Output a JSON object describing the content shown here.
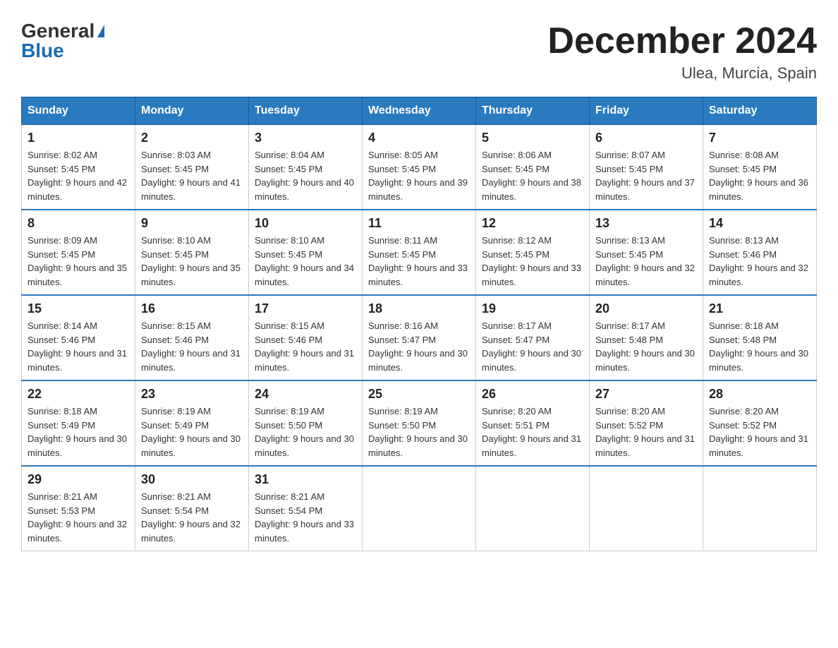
{
  "header": {
    "logo_general": "General",
    "logo_blue": "Blue",
    "month_title": "December 2024",
    "location": "Ulea, Murcia, Spain"
  },
  "days_of_week": [
    "Sunday",
    "Monday",
    "Tuesday",
    "Wednesday",
    "Thursday",
    "Friday",
    "Saturday"
  ],
  "weeks": [
    [
      {
        "day": "1",
        "sunrise": "8:02 AM",
        "sunset": "5:45 PM",
        "daylight": "9 hours and 42 minutes."
      },
      {
        "day": "2",
        "sunrise": "8:03 AM",
        "sunset": "5:45 PM",
        "daylight": "9 hours and 41 minutes."
      },
      {
        "day": "3",
        "sunrise": "8:04 AM",
        "sunset": "5:45 PM",
        "daylight": "9 hours and 40 minutes."
      },
      {
        "day": "4",
        "sunrise": "8:05 AM",
        "sunset": "5:45 PM",
        "daylight": "9 hours and 39 minutes."
      },
      {
        "day": "5",
        "sunrise": "8:06 AM",
        "sunset": "5:45 PM",
        "daylight": "9 hours and 38 minutes."
      },
      {
        "day": "6",
        "sunrise": "8:07 AM",
        "sunset": "5:45 PM",
        "daylight": "9 hours and 37 minutes."
      },
      {
        "day": "7",
        "sunrise": "8:08 AM",
        "sunset": "5:45 PM",
        "daylight": "9 hours and 36 minutes."
      }
    ],
    [
      {
        "day": "8",
        "sunrise": "8:09 AM",
        "sunset": "5:45 PM",
        "daylight": "9 hours and 35 minutes."
      },
      {
        "day": "9",
        "sunrise": "8:10 AM",
        "sunset": "5:45 PM",
        "daylight": "9 hours and 35 minutes."
      },
      {
        "day": "10",
        "sunrise": "8:10 AM",
        "sunset": "5:45 PM",
        "daylight": "9 hours and 34 minutes."
      },
      {
        "day": "11",
        "sunrise": "8:11 AM",
        "sunset": "5:45 PM",
        "daylight": "9 hours and 33 minutes."
      },
      {
        "day": "12",
        "sunrise": "8:12 AM",
        "sunset": "5:45 PM",
        "daylight": "9 hours and 33 minutes."
      },
      {
        "day": "13",
        "sunrise": "8:13 AM",
        "sunset": "5:45 PM",
        "daylight": "9 hours and 32 minutes."
      },
      {
        "day": "14",
        "sunrise": "8:13 AM",
        "sunset": "5:46 PM",
        "daylight": "9 hours and 32 minutes."
      }
    ],
    [
      {
        "day": "15",
        "sunrise": "8:14 AM",
        "sunset": "5:46 PM",
        "daylight": "9 hours and 31 minutes."
      },
      {
        "day": "16",
        "sunrise": "8:15 AM",
        "sunset": "5:46 PM",
        "daylight": "9 hours and 31 minutes."
      },
      {
        "day": "17",
        "sunrise": "8:15 AM",
        "sunset": "5:46 PM",
        "daylight": "9 hours and 31 minutes."
      },
      {
        "day": "18",
        "sunrise": "8:16 AM",
        "sunset": "5:47 PM",
        "daylight": "9 hours and 30 minutes."
      },
      {
        "day": "19",
        "sunrise": "8:17 AM",
        "sunset": "5:47 PM",
        "daylight": "9 hours and 30 minutes."
      },
      {
        "day": "20",
        "sunrise": "8:17 AM",
        "sunset": "5:48 PM",
        "daylight": "9 hours and 30 minutes."
      },
      {
        "day": "21",
        "sunrise": "8:18 AM",
        "sunset": "5:48 PM",
        "daylight": "9 hours and 30 minutes."
      }
    ],
    [
      {
        "day": "22",
        "sunrise": "8:18 AM",
        "sunset": "5:49 PM",
        "daylight": "9 hours and 30 minutes."
      },
      {
        "day": "23",
        "sunrise": "8:19 AM",
        "sunset": "5:49 PM",
        "daylight": "9 hours and 30 minutes."
      },
      {
        "day": "24",
        "sunrise": "8:19 AM",
        "sunset": "5:50 PM",
        "daylight": "9 hours and 30 minutes."
      },
      {
        "day": "25",
        "sunrise": "8:19 AM",
        "sunset": "5:50 PM",
        "daylight": "9 hours and 30 minutes."
      },
      {
        "day": "26",
        "sunrise": "8:20 AM",
        "sunset": "5:51 PM",
        "daylight": "9 hours and 31 minutes."
      },
      {
        "day": "27",
        "sunrise": "8:20 AM",
        "sunset": "5:52 PM",
        "daylight": "9 hours and 31 minutes."
      },
      {
        "day": "28",
        "sunrise": "8:20 AM",
        "sunset": "5:52 PM",
        "daylight": "9 hours and 31 minutes."
      }
    ],
    [
      {
        "day": "29",
        "sunrise": "8:21 AM",
        "sunset": "5:53 PM",
        "daylight": "9 hours and 32 minutes."
      },
      {
        "day": "30",
        "sunrise": "8:21 AM",
        "sunset": "5:54 PM",
        "daylight": "9 hours and 32 minutes."
      },
      {
        "day": "31",
        "sunrise": "8:21 AM",
        "sunset": "5:54 PM",
        "daylight": "9 hours and 33 minutes."
      },
      null,
      null,
      null,
      null
    ]
  ]
}
